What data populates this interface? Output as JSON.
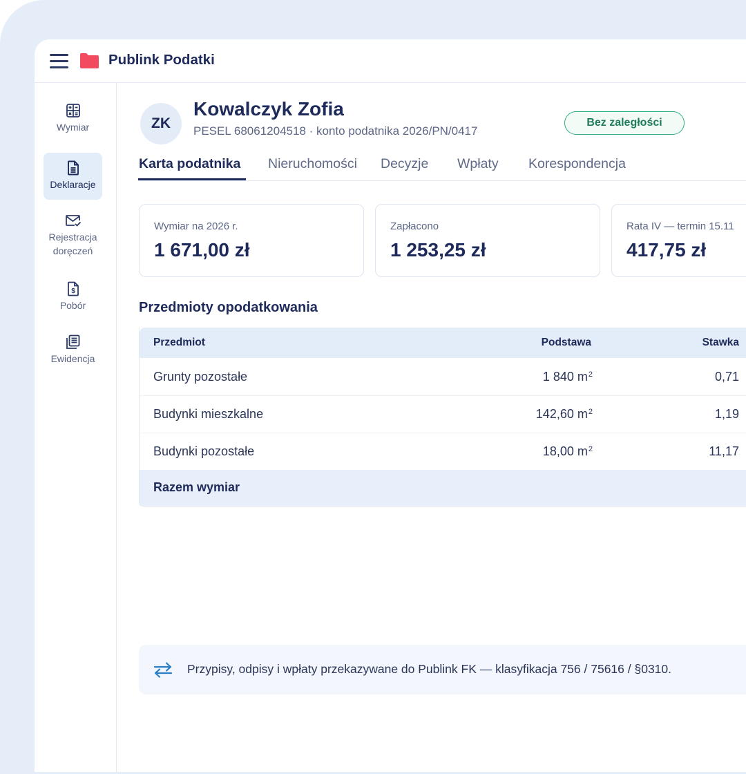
{
  "app": {
    "name": "Publink Podatki",
    "colors": {
      "brand": "#f24a5f",
      "primary": "#1e2a5a",
      "accent": "#2a7fc9",
      "success": "#2fae86"
    }
  },
  "sidebar": {
    "items": [
      {
        "label": "Wymiar",
        "icon": "calculator-icon",
        "active": false
      },
      {
        "label": "Deklaracje",
        "icon": "document-icon",
        "active": true
      },
      {
        "label": "Rejestracja",
        "label2": "doręczeń",
        "icon": "mail-check-icon",
        "active": false
      },
      {
        "label": "Pobór",
        "icon": "payment-file-icon",
        "active": false
      },
      {
        "label": "Ewidencja",
        "icon": "register-icon",
        "active": false
      }
    ]
  },
  "taxpayer": {
    "initials": "ZK",
    "name": "Kowalczyk Zofia",
    "meta": "PESEL 68061204518 · konto podatnika 2026/PN/0417",
    "status": "Bez zaległości"
  },
  "tabs": [
    {
      "label": "Karta podatnika",
      "active": true
    },
    {
      "label": "Nieruchomości",
      "active": false
    },
    {
      "label": "Decyzje",
      "active": false
    },
    {
      "label": "Wpłaty",
      "active": false
    },
    {
      "label": "Korespondencja",
      "active": false
    }
  ],
  "summary_cards": [
    {
      "label": "Wymiar na 2026 r.",
      "value": "1 671,00 zł"
    },
    {
      "label": "Zapłacono",
      "value": "1 253,25 zł"
    },
    {
      "label": "Rata IV — termin 15.11",
      "value": "417,75 zł"
    }
  ],
  "subjects": {
    "title": "Przedmioty opodatkowania",
    "columns": [
      "Przedmiot",
      "Podstawa",
      "Stawka"
    ],
    "unit": "m",
    "unit_exp": "2",
    "rows": [
      {
        "subject": "Grunty pozostałe",
        "base": "1 840",
        "rate": "0,71"
      },
      {
        "subject": "Budynki mieszkalne",
        "base": "142,60",
        "rate": "1,19"
      },
      {
        "subject": "Budynki pozostałe",
        "base": "18,00",
        "rate": "11,17"
      }
    ],
    "total_label": "Razem wymiar"
  },
  "info": {
    "text": "Przypisy, odpisy i wpłaty przekazywane do Publink FK — klasyfikacja 756 / 75616 / §0310.",
    "icon": "transfer-arrows-icon"
  }
}
